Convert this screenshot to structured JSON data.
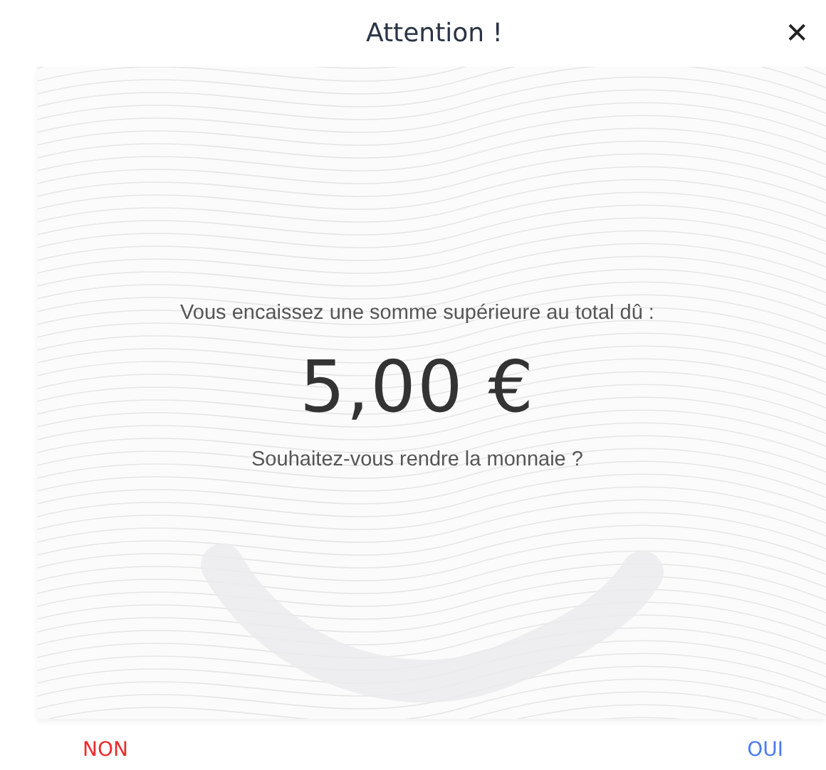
{
  "dialog": {
    "title": "Attention !",
    "close_label": "✕"
  },
  "message": {
    "intro": "Vous encaissez une somme supérieure au total dû :",
    "amount": "5,00 €",
    "question": "Souhaitez-vous rendre la monnaie ?"
  },
  "buttons": [
    {
      "label": "NON",
      "color": "#ee2a2a"
    },
    {
      "label": "OUI",
      "color": "#4a7bf0"
    }
  ]
}
